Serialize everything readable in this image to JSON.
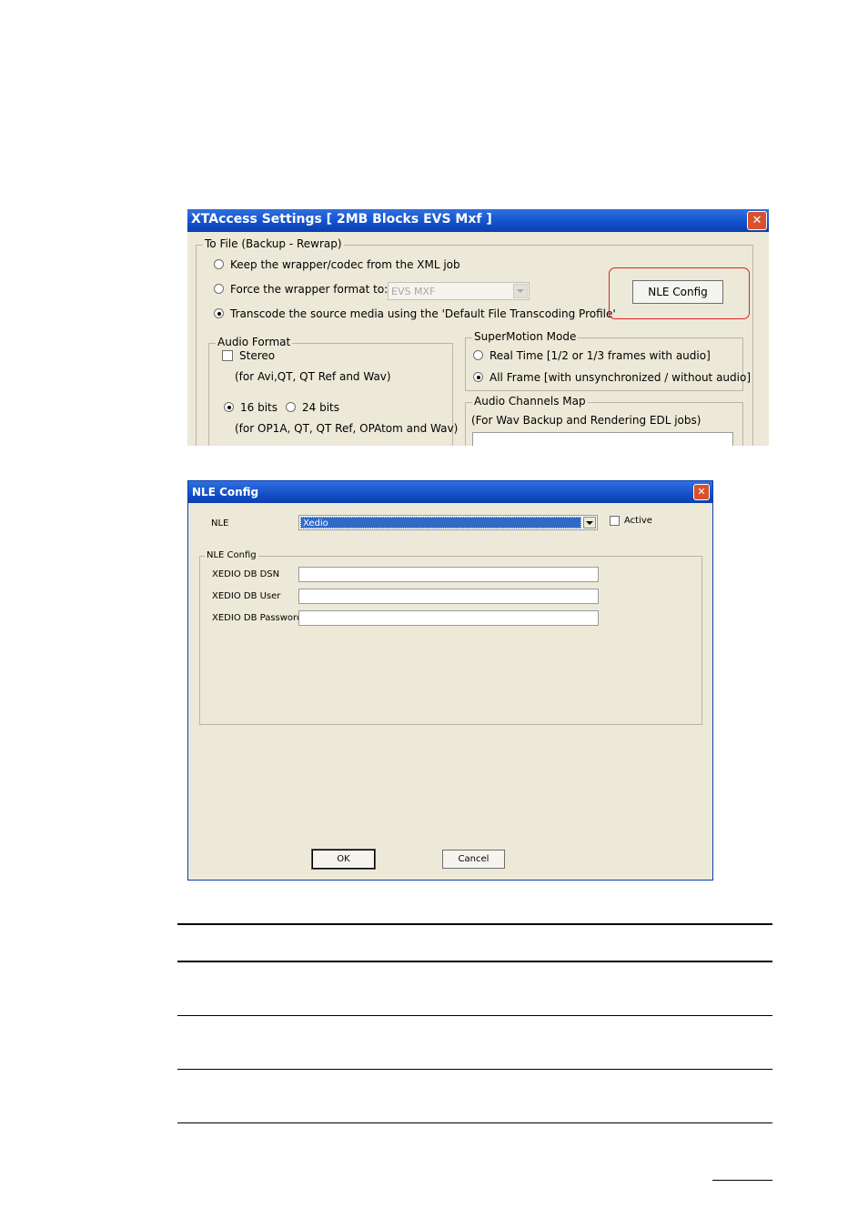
{
  "xtaccess": {
    "title": "XTAccess Settings [ 2MB Blocks EVS Mxf ]",
    "close_glyph": "✕",
    "to_file": {
      "label": "To File (Backup - Rewrap)",
      "keep": "Keep the wrapper/codec from the XML job",
      "force": "Force the wrapper format to:",
      "force_value": "EVS MXF",
      "transcode": "Transcode the source media using the 'Default File Transcoding Profile'",
      "nle_button": "NLE Config"
    },
    "audio_format": {
      "label": "Audio Format",
      "stereo": "Stereo",
      "stereo_note": "(for Avi,QT, QT Ref and Wav)",
      "bits16": "16 bits",
      "bits24": "24 bits",
      "bits_note": "(for OP1A, QT, QT Ref, OPAtom and Wav)"
    },
    "supermotion": {
      "label": "SuperMotion Mode",
      "realtime": "Real Time [1/2 or 1/3 frames with audio]",
      "allframe": "All Frame [with unsynchronized / without audio]"
    },
    "audio_map": {
      "label": "Audio Channels Map",
      "note": "(For Wav Backup and Rendering EDL jobs)"
    }
  },
  "nle": {
    "title": "NLE Config",
    "close_glyph": "✕",
    "nle_label": "NLE",
    "nle_value": "Xedio",
    "active": "Active",
    "group_label": "NLE Config",
    "dsn_label": "XEDIO DB DSN",
    "user_label": "XEDIO DB User",
    "password_label": "XEDIO DB Password",
    "ok": "OK",
    "cancel": "Cancel"
  },
  "colors": {
    "title_blue": "#1250c8",
    "dialog_bg": "#ece9d8",
    "close_red": "#d8512f",
    "highlight_red": "#e02020",
    "selection_blue": "#316ac5"
  }
}
